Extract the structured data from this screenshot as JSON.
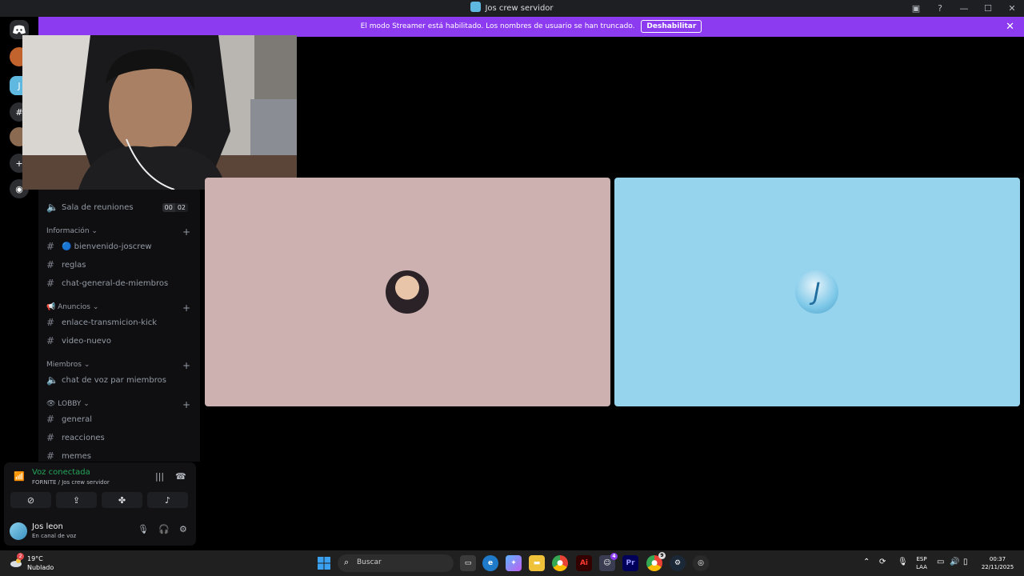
{
  "window": {
    "title": "Jos crew servidor"
  },
  "banner": {
    "text": "El modo Streamer está habilitado. Los nombres de usuario se han truncado.",
    "button": "Deshabilitar"
  },
  "channels": {
    "voice_room": {
      "name": "Sala de reuniones",
      "count_a": "00",
      "count_b": "02"
    },
    "categories": [
      {
        "label": "Información ⌄"
      },
      {
        "label": "📢 Anuncios ⌄"
      },
      {
        "label": "Miembros ⌄"
      },
      {
        "label": "👁 LOBBY ⌄"
      }
    ],
    "items": [
      {
        "name": "🔵 bienvenido-joscrew"
      },
      {
        "name": "reglas"
      },
      {
        "name": "chat-general-de-miembros"
      },
      {
        "name": "enlace-transmicion-kick"
      },
      {
        "name": "video-nuevo"
      },
      {
        "name": "chat de voz par miembros"
      },
      {
        "name": "general"
      },
      {
        "name": "reacciones"
      },
      {
        "name": "memes"
      }
    ]
  },
  "voice": {
    "status": "Voz conectada",
    "location": "FORNITE / Jos crew servidor"
  },
  "user": {
    "name": "Jos leon",
    "status": "En canal de voz"
  },
  "tiles": [
    {
      "bg": "#cdb0b0"
    },
    {
      "bg": "#96d4ee"
    }
  ],
  "taskbar": {
    "temp": "19°C",
    "weather": "Nublado",
    "search_label": "Buscar",
    "lang_a": "ESP",
    "lang_b": "LAA",
    "time": "00:37",
    "date": "22/11/2025",
    "weather_badge": "2",
    "discord_badge": "4",
    "chrome_badge": "9"
  },
  "colors": {
    "accent": "#8c3bf0",
    "voice_green": "#23a55a"
  }
}
